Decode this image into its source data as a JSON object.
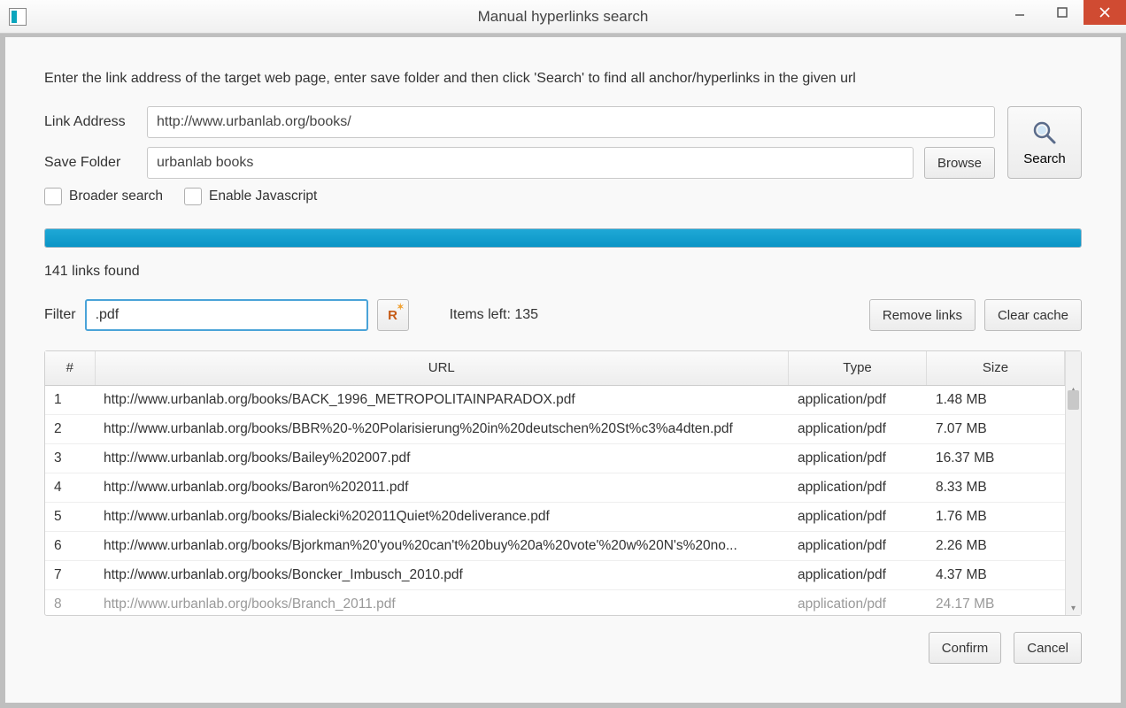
{
  "window": {
    "title": "Manual hyperlinks search"
  },
  "instruction": "Enter the link address of the target web page, enter save folder and then click 'Search' to find all anchor/hyperlinks in the given url",
  "form": {
    "link_label": "Link Address",
    "link_value": "http://www.urbanlab.org/books/",
    "folder_label": "Save Folder",
    "folder_value": "urbanlab books",
    "browse_label": "Browse",
    "search_label": "Search",
    "broader_label": "Broader search",
    "js_label": "Enable Javascript"
  },
  "status": "141 links found",
  "filter": {
    "label": "Filter",
    "value": ".pdf",
    "regex_label": "R",
    "items_left": "Items left: 135",
    "remove_label": "Remove links",
    "clear_label": "Clear cache"
  },
  "table": {
    "headers": {
      "num": "#",
      "url": "URL",
      "type": "Type",
      "size": "Size"
    },
    "rows": [
      {
        "n": "1",
        "url": "http://www.urbanlab.org/books/BACK_1996_METROPOLITAINPARADOX.pdf",
        "type": "application/pdf",
        "size": "1.48 MB"
      },
      {
        "n": "2",
        "url": "http://www.urbanlab.org/books/BBR%20-%20Polarisierung%20in%20deutschen%20St%c3%a4dten.pdf",
        "type": "application/pdf",
        "size": "7.07 MB"
      },
      {
        "n": "3",
        "url": "http://www.urbanlab.org/books/Bailey%202007.pdf",
        "type": "application/pdf",
        "size": "16.37 MB"
      },
      {
        "n": "4",
        "url": "http://www.urbanlab.org/books/Baron%202011.pdf",
        "type": "application/pdf",
        "size": "8.33 MB"
      },
      {
        "n": "5",
        "url": "http://www.urbanlab.org/books/Bialecki%202011Quiet%20deliverance.pdf",
        "type": "application/pdf",
        "size": "1.76 MB"
      },
      {
        "n": "6",
        "url": "http://www.urbanlab.org/books/Bjorkman%20'you%20can't%20buy%20a%20vote'%20w%20N's%20no...",
        "type": "application/pdf",
        "size": "2.26 MB"
      },
      {
        "n": "7",
        "url": "http://www.urbanlab.org/books/Boncker_Imbusch_2010.pdf",
        "type": "application/pdf",
        "size": "4.37 MB"
      },
      {
        "n": "8",
        "url": "http://www.urbanlab.org/books/Branch_2011.pdf",
        "type": "application/pdf",
        "size": "24.17 MB"
      }
    ]
  },
  "footer": {
    "confirm": "Confirm",
    "cancel": "Cancel"
  }
}
